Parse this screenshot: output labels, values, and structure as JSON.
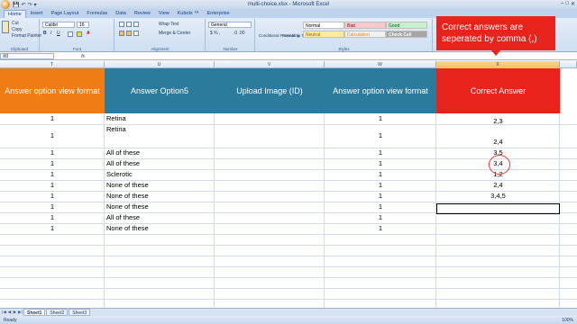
{
  "window": {
    "title": "multi-choice.xlsx - Microsoft Excel",
    "qat": [
      "💾",
      "↶",
      "↷",
      "▾"
    ],
    "controls": [
      "–",
      "□",
      "✕"
    ]
  },
  "ribbon_tabs": [
    "Home",
    "Insert",
    "Page Layout",
    "Formulas",
    "Data",
    "Review",
    "View",
    "Kubols ™",
    "Enterprise"
  ],
  "ribbon": {
    "clipboard": {
      "cut": "Cut",
      "copy": "Copy",
      "format_painter": "Format Painter",
      "label": "Clipboard"
    },
    "font": {
      "name": "Calibri",
      "size": "16",
      "label": "Font"
    },
    "alignment": {
      "wrap": "Wrap Text",
      "merge": "Merge & Center",
      "label": "Alignment"
    },
    "number": {
      "format": "General",
      "label": "Number"
    },
    "styles": {
      "conditional": "Conditional Formatting",
      "format_table": "Format as Table",
      "cells": [
        {
          "label": "Normal",
          "bg": "#ffffff",
          "fg": "#000000"
        },
        {
          "label": "Bad",
          "bg": "#ffc7ce",
          "fg": "#9c0006"
        },
        {
          "label": "Good",
          "bg": "#c6efce",
          "fg": "#006100"
        },
        {
          "label": "Neutral",
          "bg": "#ffeb9c",
          "fg": "#9c6500"
        },
        {
          "label": "Calculation",
          "bg": "#f2f2f2",
          "fg": "#fa7d00"
        },
        {
          "label": "Check Cell",
          "bg": "#a5a5a5",
          "fg": "#ffffff"
        }
      ],
      "label": "Styles"
    }
  },
  "formula_bar": {
    "name_box": "X0",
    "fx": "fx"
  },
  "columns": [
    {
      "letter": "T",
      "w": 116
    },
    {
      "letter": "U",
      "w": 122
    },
    {
      "letter": "V",
      "w": 122
    },
    {
      "letter": "W",
      "w": 124
    },
    {
      "letter": "X",
      "w": 137
    }
  ],
  "headers": [
    {
      "text": "Answer option view format",
      "bg": "#f07c14"
    },
    {
      "text": "Answer Option5",
      "bg": "#2c7a9c"
    },
    {
      "text": "Upload Image (ID)",
      "bg": "#2c7a9c"
    },
    {
      "text": "Answer option view format",
      "bg": "#2c7a9c"
    },
    {
      "text": "Correct Answer",
      "bg": "#e8231b"
    }
  ],
  "rows": [
    {
      "t": "1",
      "u": "Retina",
      "w": "1",
      "x": "2,3"
    },
    {
      "t": "1",
      "u": "Retina",
      "w": "1",
      "x": "2,4"
    },
    {
      "t": "1",
      "u": "All of these",
      "w": "1",
      "x": "3,5"
    },
    {
      "t": "1",
      "u": "All of these",
      "w": "1",
      "x": "3,4"
    },
    {
      "t": "1",
      "u": "Sclerotic",
      "w": "1",
      "x": "1,2"
    },
    {
      "t": "1",
      "u": "None of these",
      "w": "1",
      "x": "2,4"
    },
    {
      "t": "1",
      "u": "None of these",
      "w": "1",
      "x": "3,4,5"
    },
    {
      "t": "1",
      "u": "None of these",
      "w": "1",
      "x": ""
    },
    {
      "t": "1",
      "u": "All of these",
      "w": "1",
      "x": ""
    },
    {
      "t": "1",
      "u": "None of these",
      "w": "1",
      "x": ""
    }
  ],
  "callout": {
    "text": "Correct answers are seperated by comma (,)",
    "color": "#e8231b"
  },
  "sheet_tabs": [
    "Sheet1",
    "Sheet2",
    "Sheet3"
  ],
  "status": {
    "left": "Ready",
    "zoom": "100%"
  }
}
